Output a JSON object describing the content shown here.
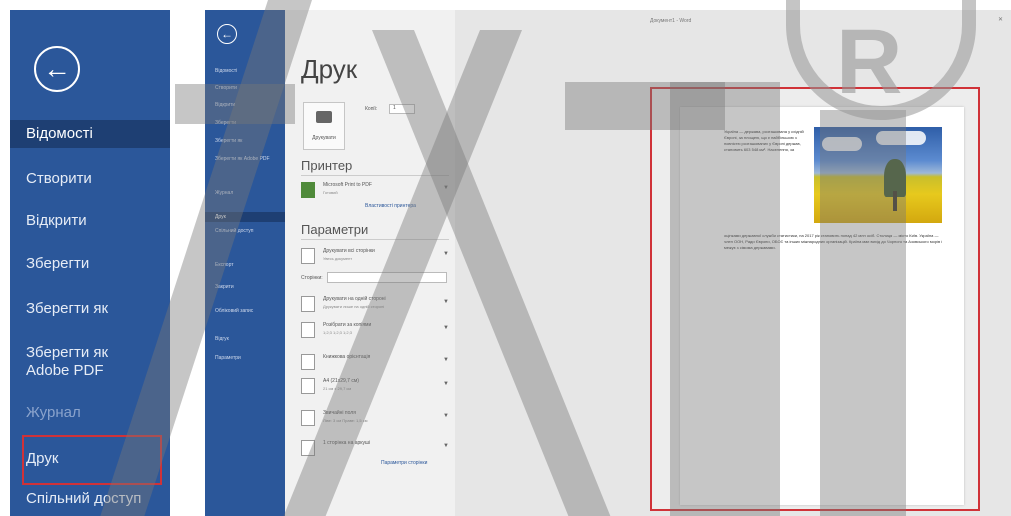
{
  "left_panel": {
    "items": [
      {
        "label": "Відомості",
        "state": "active"
      },
      {
        "label": "Створити",
        "state": "normal"
      },
      {
        "label": "Відкрити",
        "state": "normal"
      },
      {
        "label": "Зберегти",
        "state": "normal"
      },
      {
        "label": "Зберегти як",
        "state": "normal"
      },
      {
        "label": "Зберегти як Adobe PDF",
        "state": "normal"
      },
      {
        "label": "Журнал",
        "state": "dim"
      },
      {
        "label": "Друк",
        "state": "highlighted"
      },
      {
        "label": "Спільний доступ",
        "state": "normal"
      }
    ]
  },
  "mid_panel": {
    "items": [
      "Відомості",
      "Створити",
      "Відкрити",
      "Зберегти",
      "Зберегти як",
      "Зберегти як Adobe PDF",
      "Журнал",
      "Друк",
      "Спільний доступ",
      "Експорт",
      "Закрити",
      "Обліковий запис",
      "Відгук",
      "Параметри"
    ],
    "active_index": 7
  },
  "print_pane": {
    "title": "Друк",
    "print_button": "Друкувати",
    "copies_label": "Копії:",
    "copies_value": "1",
    "printer_header": "Принтер",
    "printer_name": "Microsoft Print to PDF",
    "printer_status": "Готовий",
    "printer_props_link": "Властивості принтера",
    "settings_header": "Параметри",
    "settings": [
      {
        "t1": "Друкувати всі сторінки",
        "t2": "Увесь документ"
      },
      {
        "t1": "Друкувати на одній стороні",
        "t2": "Друкувати лише на одній стороні"
      },
      {
        "t1": "Розібрати за копіями",
        "t2": "1;2;3   1;2;3   1;2;3"
      },
      {
        "t1": "Книжкова орієнтація",
        "t2": ""
      },
      {
        "t1": "А4 (21x29,7 см)",
        "t2": "21 см x 29,7 см"
      },
      {
        "t1": "Звичайні поля",
        "t2": "Ліве: 3 см   Праве: 1,5 см"
      },
      {
        "t1": "1 сторінка на аркуші",
        "t2": ""
      }
    ],
    "pages_label": "Сторінки:",
    "page_setup_link": "Параметри сторінки"
  },
  "preview": {
    "doc_title": "Документ1 - Word",
    "close_glyph": "✕",
    "paragraph_top": "Україна — держава, розташована у східній Європі, за площею, що є найбільшою з повністю розташованих у Європі держав, становить 603 548 км². Населення, за",
    "paragraph_bottom": "оцінками державної служби статистики, на 2017 рік становить понад 42 млн осіб. Столиця — місто Київ. Україна — член ООН, Ради Європи, ОБСЄ та інших міжнародних організацій. Країна має вихід до Чорного та Азовського морів і межує з сімома державами."
  }
}
